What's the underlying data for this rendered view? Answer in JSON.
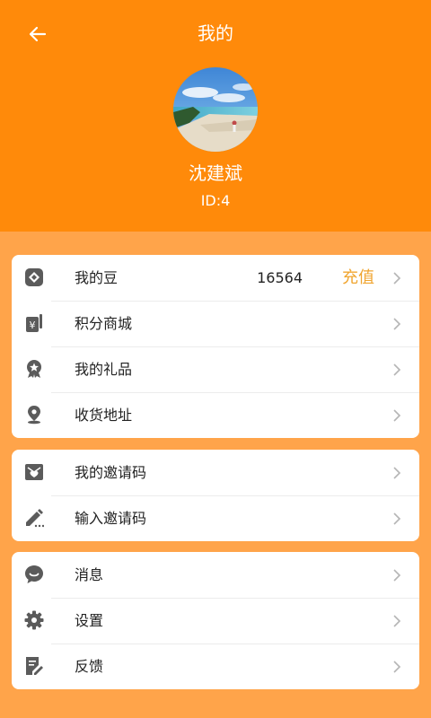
{
  "header": {
    "title": "我的",
    "username": "沈建斌",
    "user_id": "ID:4",
    "back_icon": "arrow-left-icon",
    "background_color": "#ff8a0a"
  },
  "menu_groups": [
    {
      "items": [
        {
          "label": "我的豆",
          "value": "16564",
          "action": "充值",
          "icon": "bean-icon"
        },
        {
          "label": "积分商城",
          "icon": "points-mall-icon"
        },
        {
          "label": "我的礼品",
          "icon": "gift-badge-icon"
        },
        {
          "label": "收货地址",
          "icon": "location-pin-icon"
        }
      ]
    },
    {
      "items": [
        {
          "label": "我的邀请码",
          "icon": "invite-card-icon"
        },
        {
          "label": "输入邀请码",
          "icon": "pencil-icon"
        }
      ]
    },
    {
      "items": [
        {
          "label": "消息",
          "icon": "message-icon"
        },
        {
          "label": "设置",
          "icon": "gear-icon"
        },
        {
          "label": "反馈",
          "icon": "feedback-icon"
        }
      ]
    }
  ],
  "colors": {
    "header_orange": "#ff8a0a",
    "page_orange": "#ffa44a",
    "recharge_gold": "#f0a530",
    "icon_gray": "#5b5b5b"
  }
}
